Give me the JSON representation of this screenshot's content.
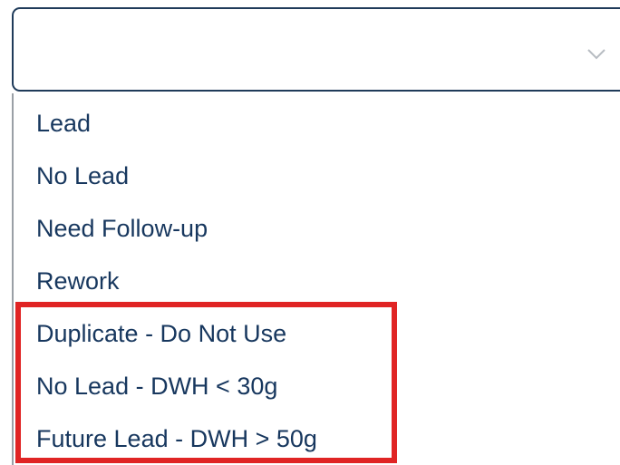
{
  "select": {
    "value": "",
    "chevron_icon": "chevron-down-icon"
  },
  "options": [
    "Lead",
    "No Lead",
    "Need Follow-up",
    "Rework",
    "Duplicate - Do Not Use",
    "No Lead - DWH < 30g",
    "Future Lead - DWH > 50g"
  ],
  "colors": {
    "text": "#17375e",
    "select_border": "#1f3b5a",
    "annotation": "#e02424"
  }
}
